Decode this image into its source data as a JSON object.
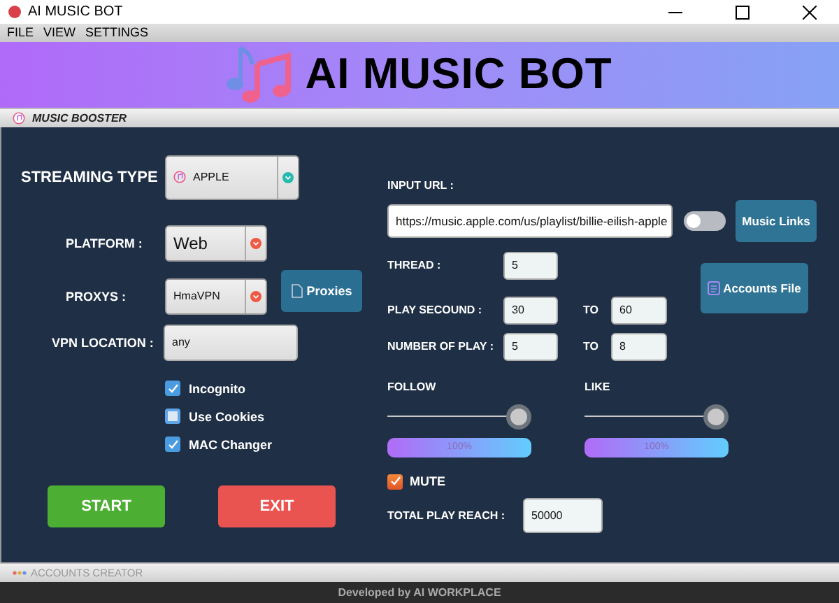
{
  "window": {
    "title": "AI MUSIC BOT"
  },
  "menu": [
    "FILE",
    "VIEW",
    "SETTINGS"
  ],
  "banner": {
    "title": "AI MUSIC BOT"
  },
  "section": {
    "title": "MUSIC BOOSTER"
  },
  "streaming_type": {
    "label": "STREAMING TYPE",
    "value": "APPLE"
  },
  "platform": {
    "label": "PLATFORM :",
    "value": "Web"
  },
  "proxys": {
    "label": "PROXYS :",
    "value": "HmaVPN"
  },
  "proxies_button": "Proxies",
  "vpn_location": {
    "label": "VPN LOCATION :",
    "value": "any"
  },
  "options": [
    {
      "label": "Incognito",
      "checked": true
    },
    {
      "label": "Use Cookies",
      "checked": false
    },
    {
      "label": "MAC Changer",
      "checked": true
    }
  ],
  "start_button": "START",
  "exit_button": "EXIT",
  "input_url": {
    "label": "INPUT URL :",
    "value": "https://music.apple.com/us/playlist/billie-eilish-apple"
  },
  "links_toggle": {
    "on": false
  },
  "music_links_button": "Music Links",
  "thread": {
    "label": "THREAD :",
    "value": "5"
  },
  "play_second": {
    "label": "PLAY SECOUND :",
    "from": "30",
    "to_label": "TO",
    "to": "60"
  },
  "number_of_play": {
    "label": "NUMBER OF PLAY :",
    "from": "5",
    "to_label": "TO",
    "to": "8"
  },
  "accounts_file_button": "Accounts File",
  "sliders": [
    {
      "label": "FOLLOW",
      "level": 1,
      "reading": "100%"
    },
    {
      "label": "LIKE",
      "level": 1,
      "reading": "100%"
    }
  ],
  "mute": {
    "label": "MUTE",
    "checked": true
  },
  "total_play_reach": {
    "label": "TOTAL PLAY REACH :",
    "value": "50000"
  },
  "accounts_creator": {
    "title": "ACCOUNTS CREATOR"
  },
  "footer": "Developed by AI WORKPLACE"
}
